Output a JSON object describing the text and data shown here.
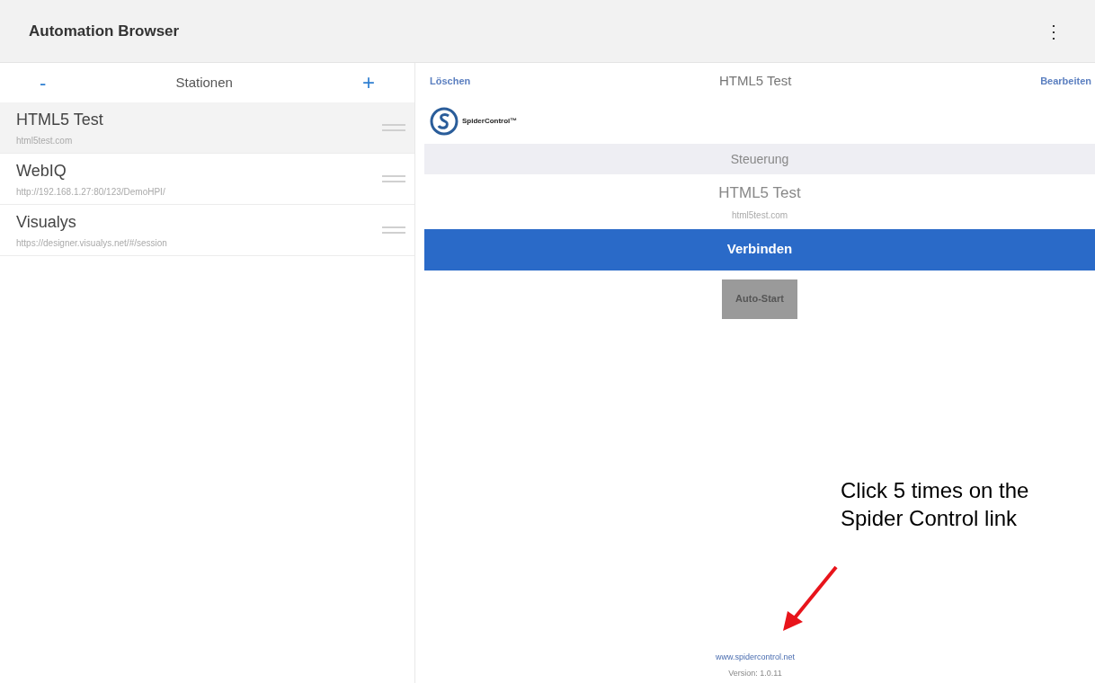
{
  "app_bar": {
    "title": "Automation Browser",
    "menu": "⋮"
  },
  "stations": {
    "remove": "-",
    "title": "Stationen",
    "add": "+",
    "items": [
      {
        "name": "HTML5 Test",
        "url": "html5test.com",
        "selected": true
      },
      {
        "name": "WebIQ",
        "url": "http://192.168.1.27:80/123/DemoHPI/",
        "selected": false
      },
      {
        "name": "Visualys",
        "url": "https://designer.visualys.net/#/session",
        "selected": false
      }
    ]
  },
  "detail": {
    "delete": "Löschen",
    "title": "HTML5 Test",
    "edit": "Bearbeiten",
    "logo_text": "SpiderControl™",
    "section": "Steuerung",
    "station_name": "HTML5 Test",
    "station_url": "html5test.com",
    "connect": "Verbinden",
    "autostart": "Auto-Start",
    "footer_link": "www.spidercontrol.net",
    "version": "Version: 1.0.11"
  },
  "annotation": "Click 5 times on the Spider Control link"
}
